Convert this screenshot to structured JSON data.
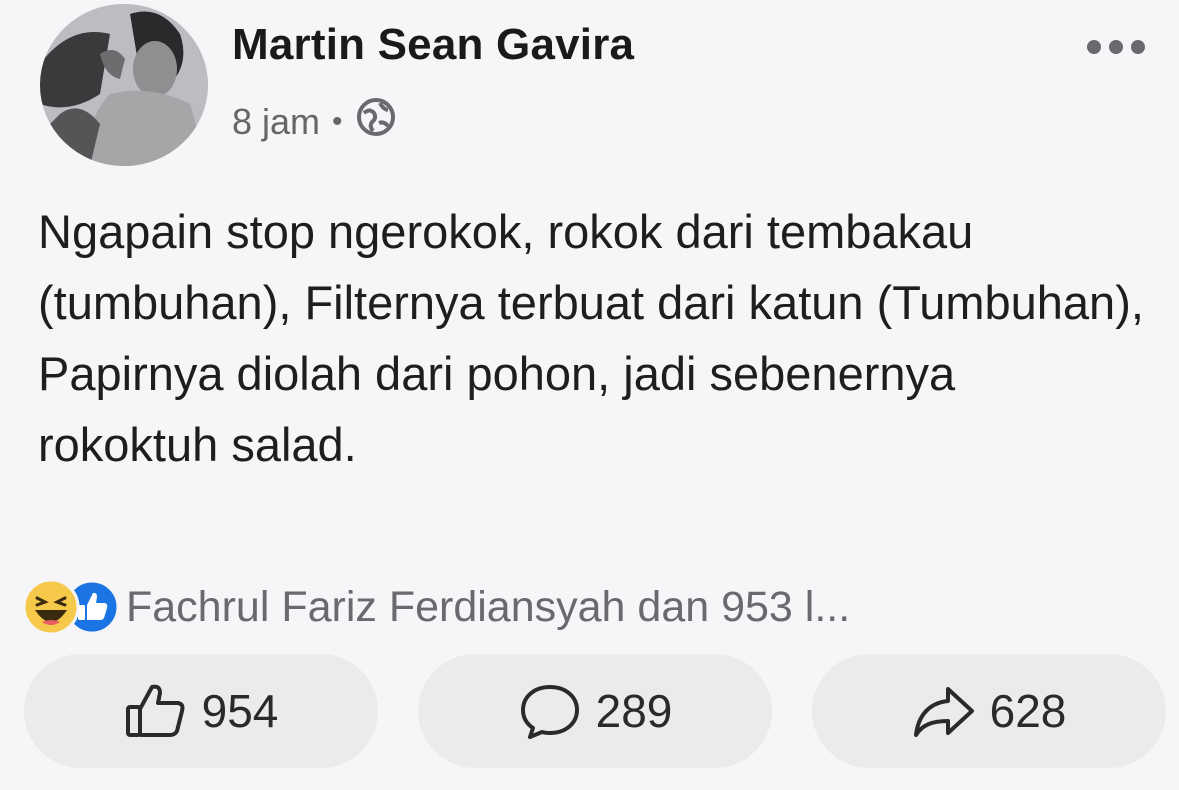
{
  "post": {
    "author": "Martin Sean Gavira",
    "time": "8 jam",
    "separator": "•",
    "privacy_icon": "globe-icon",
    "text": "Ngapain stop ngerokok, rokok dari tembakau (tumbuhan), Filternya terbuat dari katun (Tumbuhan), Papirnya diolah dari pohon, jadi sebenernya rokoktuh salad."
  },
  "reactions": {
    "icons": [
      "haha-icon",
      "like-icon"
    ],
    "summary": "Fachrul Fariz Ferdiansyah dan 953 l..."
  },
  "actions": {
    "like_count": "954",
    "comment_count": "289",
    "share_count": "628"
  },
  "colors": {
    "background": "#f6f6f8",
    "button_bg": "#ebebee",
    "like_blue": "#1b74e4",
    "haha_yellow": "#f7c94a"
  }
}
